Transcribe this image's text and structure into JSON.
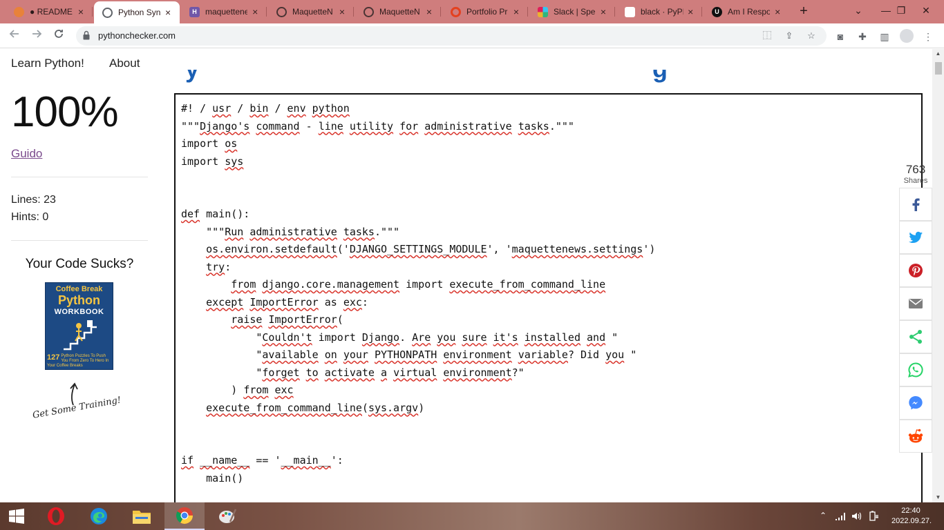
{
  "browser": {
    "tabs": [
      {
        "title": "● README",
        "favicon": "gitpod-icon",
        "color": "#e8823a"
      },
      {
        "title": "Python Syn",
        "favicon": "globe-icon",
        "color": "#5f6368"
      },
      {
        "title": "maquettene",
        "favicon": "heroku-icon",
        "color": "#7057a8"
      },
      {
        "title": "MaquetteN",
        "favicon": "globe-icon",
        "color": "#5f6368"
      },
      {
        "title": "MaquetteN",
        "favicon": "globe-icon",
        "color": "#5f6368"
      },
      {
        "title": "Portfolio Pr",
        "favicon": "opera-ring-icon",
        "color": "#e4411f"
      },
      {
        "title": "Slack | Spe",
        "favicon": "slack-icon",
        "color": "#4a154b"
      },
      {
        "title": "black · PyPI",
        "favicon": "pypi-cube-icon",
        "color": "#ffffff"
      },
      {
        "title": "Am I Respo",
        "favicon": "amiresponsive-icon",
        "color": "#111111"
      }
    ],
    "new_tab": "+",
    "controls": {
      "tab_search": "⌄",
      "minimize": "—",
      "maximize": "❐",
      "close": "✕"
    },
    "url": "pythonchecker.com"
  },
  "page": {
    "nav": {
      "learn": "Learn Python!",
      "about": "About"
    },
    "score": "100%",
    "author": "Guido",
    "lines": "Lines: 23",
    "hints": "Hints: 0",
    "promo_title": "Your Code Sucks?",
    "book": {
      "line1": "Coffee Break",
      "line2": "Python",
      "line3": "WORKBOOK",
      "count": "127",
      "subtitle": "Python Puzzles To Push You From Zero To Hero In Your Coffee Breaks"
    },
    "training_note": "Get Some Training!",
    "code_lines": [
      [
        {
          "t": "#! / "
        },
        {
          "t": "usr",
          "w": 1
        },
        {
          "t": " / "
        },
        {
          "t": "bin",
          "w": 1
        },
        {
          "t": " / "
        },
        {
          "t": "env",
          "w": 1
        },
        {
          "t": " "
        },
        {
          "t": "python",
          "w": 1
        }
      ],
      [
        {
          "t": "\"\"\""
        },
        {
          "t": "Django's",
          "w": 1
        },
        {
          "t": " "
        },
        {
          "t": "command",
          "w": 1
        },
        {
          "t": " - "
        },
        {
          "t": "line",
          "w": 1
        },
        {
          "t": " "
        },
        {
          "t": "utility",
          "w": 1
        },
        {
          "t": " "
        },
        {
          "t": "for",
          "w": 1
        },
        {
          "t": " "
        },
        {
          "t": "administrative",
          "w": 1
        },
        {
          "t": " "
        },
        {
          "t": "tasks",
          "w": 1
        },
        {
          "t": ".\"\"\""
        }
      ],
      [
        {
          "t": "import "
        },
        {
          "t": "os",
          "w": 1
        }
      ],
      [
        {
          "t": "import "
        },
        {
          "t": "sys",
          "w": 1
        }
      ],
      [],
      [],
      [
        {
          "t": "def",
          "w": 1
        },
        {
          "t": " main():"
        }
      ],
      [
        {
          "t": "    \"\"\""
        },
        {
          "t": "Run",
          "w": 1
        },
        {
          "t": " "
        },
        {
          "t": "administrative",
          "w": 1
        },
        {
          "t": " "
        },
        {
          "t": "tasks",
          "w": 1
        },
        {
          "t": ".\"\"\""
        }
      ],
      [
        {
          "t": "    "
        },
        {
          "t": "os.environ.setdefault",
          "w": 1
        },
        {
          "t": "('"
        },
        {
          "t": "DJANGO_SETTINGS_MODULE",
          "w": 1
        },
        {
          "t": "', '"
        },
        {
          "t": "maquettenews.settings",
          "w": 1
        },
        {
          "t": "')"
        }
      ],
      [
        {
          "t": "    "
        },
        {
          "t": "try",
          "w": 1
        },
        {
          "t": ":"
        }
      ],
      [
        {
          "t": "        "
        },
        {
          "t": "from",
          "w": 1
        },
        {
          "t": " "
        },
        {
          "t": "django.core.management",
          "w": 1
        },
        {
          "t": " import "
        },
        {
          "t": "execute_from_command_line",
          "w": 1
        }
      ],
      [
        {
          "t": "    "
        },
        {
          "t": "except",
          "w": 1
        },
        {
          "t": " "
        },
        {
          "t": "ImportError",
          "w": 1
        },
        {
          "t": " as "
        },
        {
          "t": "exc",
          "w": 1
        },
        {
          "t": ":"
        }
      ],
      [
        {
          "t": "        "
        },
        {
          "t": "raise",
          "w": 1
        },
        {
          "t": " "
        },
        {
          "t": "ImportError",
          "w": 1
        },
        {
          "t": "("
        }
      ],
      [
        {
          "t": "            \""
        },
        {
          "t": "Couldn't",
          "w": 1
        },
        {
          "t": " import "
        },
        {
          "t": "Django",
          "w": 1
        },
        {
          "t": ". "
        },
        {
          "t": "Are",
          "w": 1
        },
        {
          "t": " "
        },
        {
          "t": "you",
          "w": 1
        },
        {
          "t": " "
        },
        {
          "t": "sure",
          "w": 1
        },
        {
          "t": " "
        },
        {
          "t": "it's",
          "w": 1
        },
        {
          "t": " "
        },
        {
          "t": "installed",
          "w": 1
        },
        {
          "t": " "
        },
        {
          "t": "and",
          "w": 1
        },
        {
          "t": " \""
        }
      ],
      [
        {
          "t": "            \""
        },
        {
          "t": "available",
          "w": 1
        },
        {
          "t": " "
        },
        {
          "t": "on",
          "w": 1
        },
        {
          "t": " "
        },
        {
          "t": "your",
          "w": 1
        },
        {
          "t": " "
        },
        {
          "t": "PYTHONPATH",
          "w": 1
        },
        {
          "t": " "
        },
        {
          "t": "environment",
          "w": 1
        },
        {
          "t": " "
        },
        {
          "t": "variable",
          "w": 1
        },
        {
          "t": "? Did "
        },
        {
          "t": "you",
          "w": 1
        },
        {
          "t": " \""
        }
      ],
      [
        {
          "t": "            \""
        },
        {
          "t": "forget",
          "w": 1
        },
        {
          "t": " "
        },
        {
          "t": "to",
          "w": 1
        },
        {
          "t": " "
        },
        {
          "t": "activate",
          "w": 1
        },
        {
          "t": " "
        },
        {
          "t": "a",
          "w": 1
        },
        {
          "t": " "
        },
        {
          "t": "virtual",
          "w": 1
        },
        {
          "t": " "
        },
        {
          "t": "environment",
          "w": 1
        },
        {
          "t": "?\""
        }
      ],
      [
        {
          "t": "        ) "
        },
        {
          "t": "from",
          "w": 1
        },
        {
          "t": " "
        },
        {
          "t": "exc",
          "w": 1
        }
      ],
      [
        {
          "t": "    "
        },
        {
          "t": "execute_from_command_line",
          "w": 1
        },
        {
          "t": "("
        },
        {
          "t": "sys.argv",
          "w": 1
        },
        {
          "t": ")"
        }
      ],
      [],
      [],
      [
        {
          "t": "if",
          "w": 1
        },
        {
          "t": " "
        },
        {
          "t": "__name__",
          "w": 1
        },
        {
          "t": " == '"
        },
        {
          "t": "__main__",
          "w": 1
        },
        {
          "t": "':"
        }
      ],
      [
        {
          "t": "    main()"
        }
      ]
    ]
  },
  "share": {
    "count": "763",
    "label": "Shares",
    "buttons": [
      {
        "name": "facebook-icon",
        "color": "#3b5998"
      },
      {
        "name": "twitter-icon",
        "color": "#1da1f2"
      },
      {
        "name": "pinterest-icon",
        "color": "#cb2027"
      },
      {
        "name": "email-icon",
        "color": "#7d7d7d"
      },
      {
        "name": "share-icon",
        "color": "#2ecc71"
      },
      {
        "name": "whatsapp-icon",
        "color": "#25d366"
      },
      {
        "name": "messenger-icon",
        "color": "#448aff"
      },
      {
        "name": "reddit-icon",
        "color": "#ff4500"
      }
    ]
  },
  "taskbar": {
    "time": "22:40",
    "date": "2022.09.27.",
    "apps": [
      "windows-start-icon",
      "opera-icon",
      "edge-icon",
      "file-explorer-icon",
      "chrome-icon",
      "paint-icon"
    ]
  }
}
